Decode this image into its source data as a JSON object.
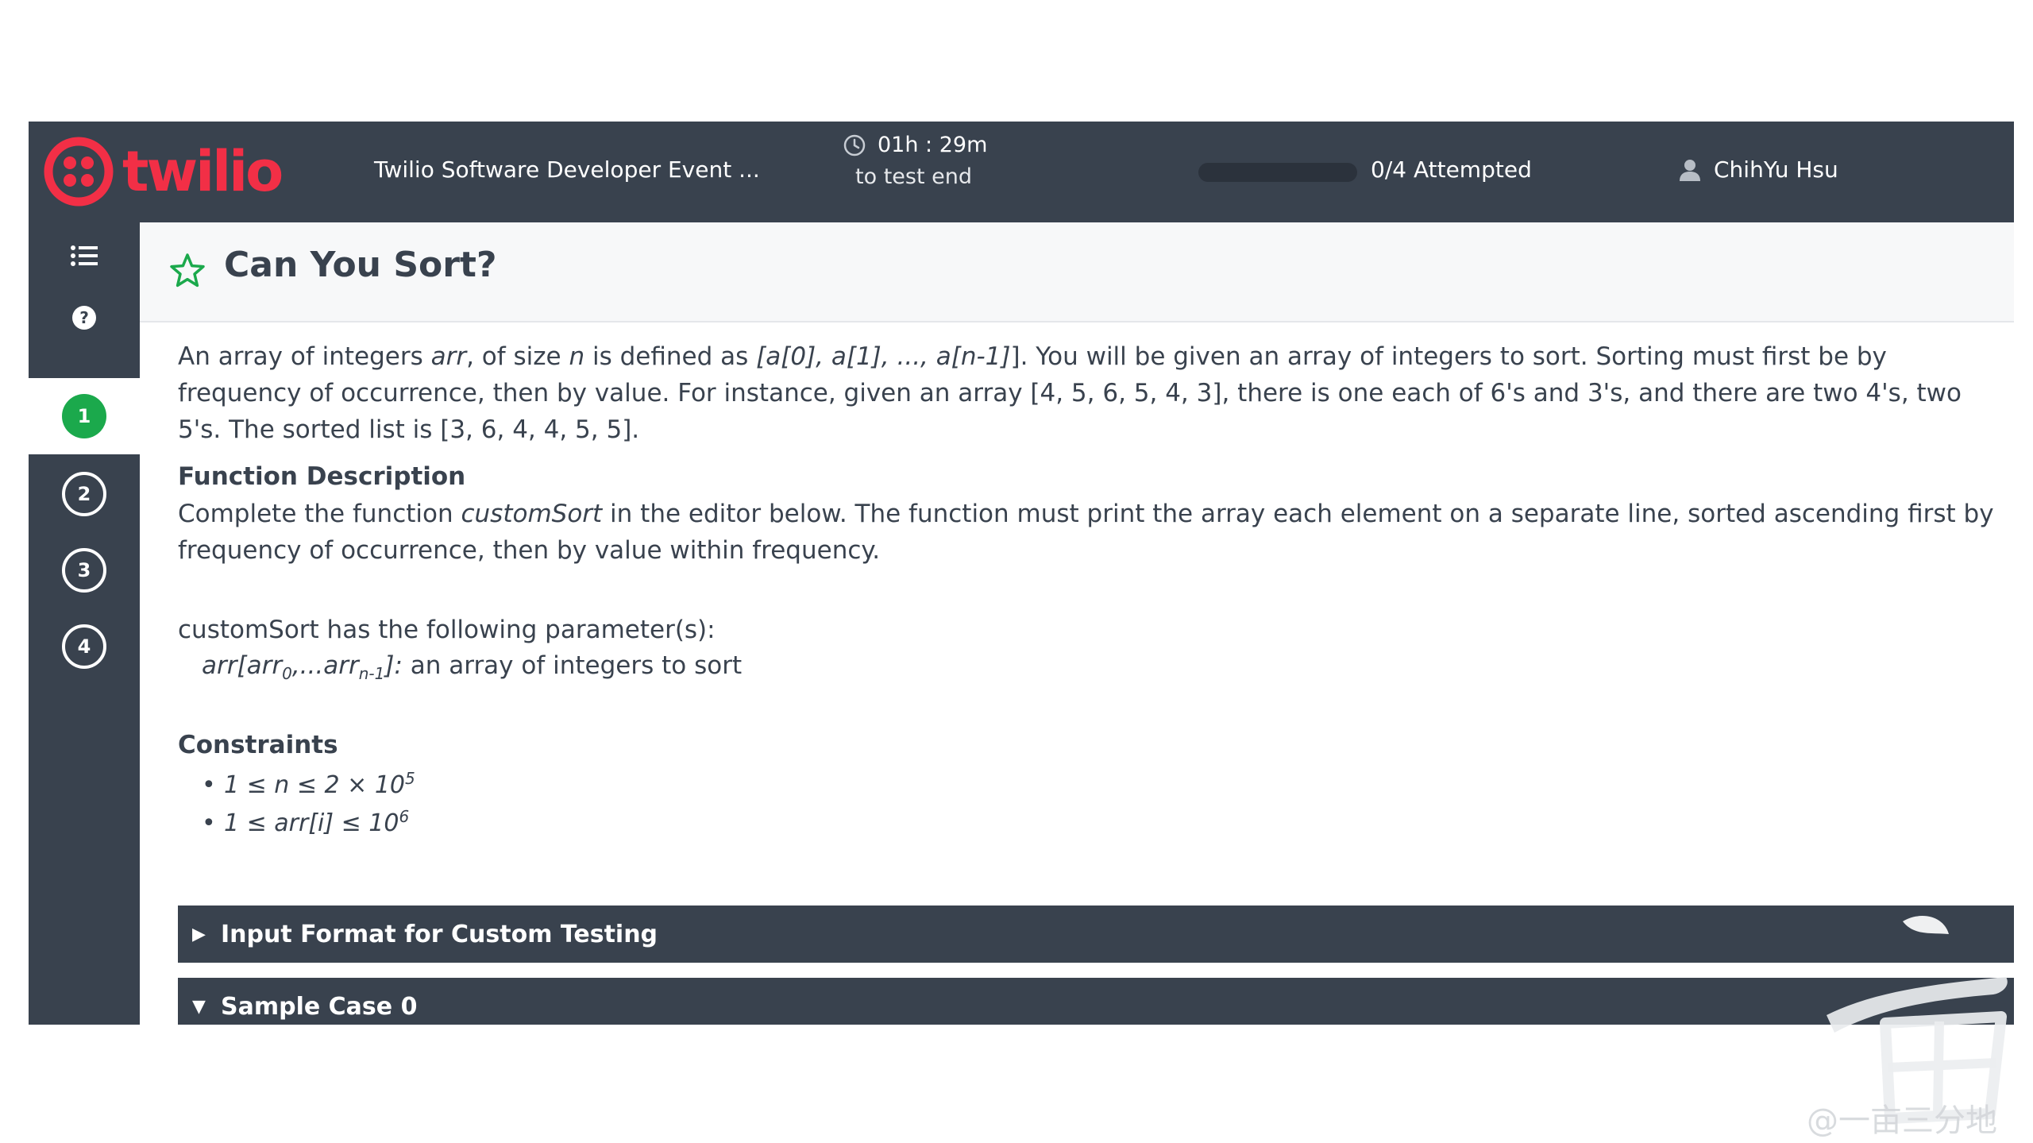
{
  "header": {
    "brand": "twilio",
    "event_title": "Twilio Software Developer Event ...",
    "timer_value": "01h : 29m",
    "timer_caption": "to test end",
    "progress_label": "0/4 Attempted",
    "progress_fraction": 0.0,
    "user_name": "ChihYu Hsu"
  },
  "sidebar": {
    "menu_icon": "list-icon",
    "help_icon": "question-circle-icon",
    "questions": [
      "1",
      "2",
      "3",
      "4"
    ],
    "active_question": "1"
  },
  "problem": {
    "title": "Can You Sort?",
    "intro": {
      "p1": "An array of integers ",
      "arr": "arr",
      "p2": ", of size ",
      "n": "n",
      "p3": " is defined as ",
      "seq": "[a[0], a[1], ..., a[n-1]",
      "p4": "]. You will be given an array of integers to sort. Sorting must first be by frequency of occurrence, then by value. For instance, given an array [4, 5, 6, 5, 4, 3], there is one each of 6's and 3's, and there are two 4's, two 5's. The sorted list is [3, 6, 4, 4, 5, 5]."
    },
    "function_description": {
      "heading": "Function Description",
      "p1": "Complete the function ",
      "fn": "customSort",
      "p2": " in the editor below. The function must print the array each element on a separate line, sorted ascending first by frequency of occurrence, then by value within frequency."
    },
    "parameters": {
      "intro": "customSort has the following parameter(s):",
      "name_a": "arr[arr",
      "sub_a": "0",
      "name_b": ",...arr",
      "sub_b": "n-1",
      "name_c": "]:",
      "desc": "  an array of integers to sort"
    },
    "constraints": {
      "heading": "Constraints",
      "bullet": "•",
      "c1_base": "1 ≤ n ≤ 2 × 10",
      "c1_exp": "5",
      "c2_base": "1 ≤ arr[i] ≤ 10",
      "c2_exp": "6"
    },
    "sections": [
      {
        "label": "Input Format for Custom Testing",
        "arrow": "▶"
      },
      {
        "label": "Sample Case 0",
        "arrow": "▼"
      }
    ]
  },
  "watermark": {
    "text": "@一亩三分地"
  },
  "colors": {
    "header_bg": "#39424e",
    "accent_green": "#1ba94c",
    "brand_red": "#f22f46"
  }
}
